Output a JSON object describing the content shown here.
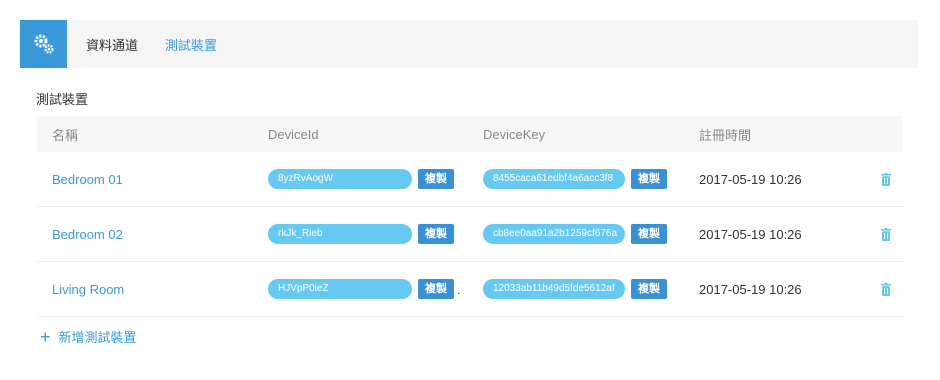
{
  "nav": {
    "tabs": [
      {
        "label": "資料通道"
      },
      {
        "label": "測試裝置"
      }
    ]
  },
  "section": {
    "title": "測試裝置"
  },
  "table": {
    "headers": [
      "名稱",
      "DeviceId",
      "DeviceKey",
      "註冊時間"
    ],
    "copy_label": "複製",
    "rows": [
      {
        "name": "Bedroom 01",
        "device_id": "8yzRvAogW",
        "device_key": "8455caca61edbf4a6acc3f8",
        "registered": "2017-05-19 10:26",
        "dot": ""
      },
      {
        "name": "Bedroom 02",
        "device_id": "rkJk_Rieb",
        "device_key": "cb8ee0aa91a2b1259cf676a",
        "registered": "2017-05-19 10:26",
        "dot": ""
      },
      {
        "name": "Living Room",
        "device_id": "HJVpP0ieZ",
        "device_key": "12033ab11b49d5fde5612af",
        "registered": "2017-05-19 10:26",
        "dot": "."
      }
    ]
  },
  "actions": {
    "add_label": "新增測試裝置"
  },
  "colors": {
    "accent": "#3a9ad9",
    "pill": "#66c9f2",
    "copy_button": "#3a90d4"
  }
}
